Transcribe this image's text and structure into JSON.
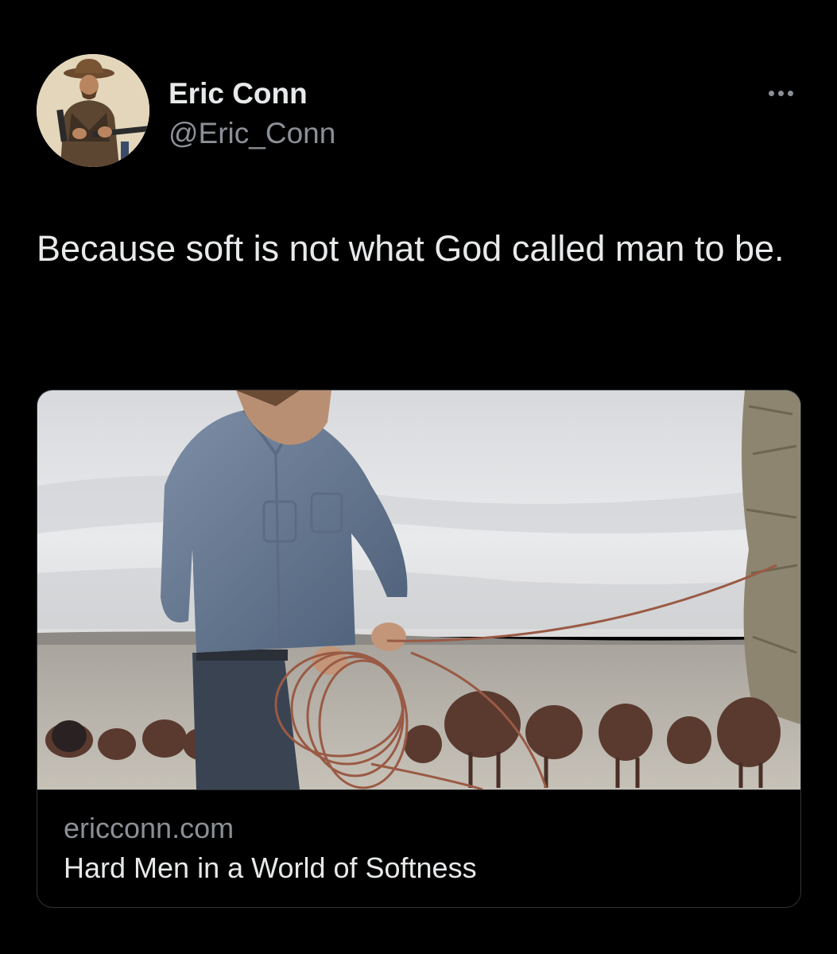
{
  "author": {
    "display_name": "Eric Conn",
    "handle": "@Eric_Conn",
    "avatar_icon": "cowboy-avatar-icon"
  },
  "more_icon": "more-dots-icon",
  "tweet": {
    "text": "Because soft is not what God called man to be."
  },
  "link_card": {
    "domain": "ericconn.com",
    "title": "Hard Men in a World of Softness",
    "image_description_icon": "rancher-with-cattle-image"
  },
  "colors": {
    "background": "#000000",
    "primary_text": "#e7e9ea",
    "secondary_text": "#8b9096",
    "border": "#2f3336"
  }
}
